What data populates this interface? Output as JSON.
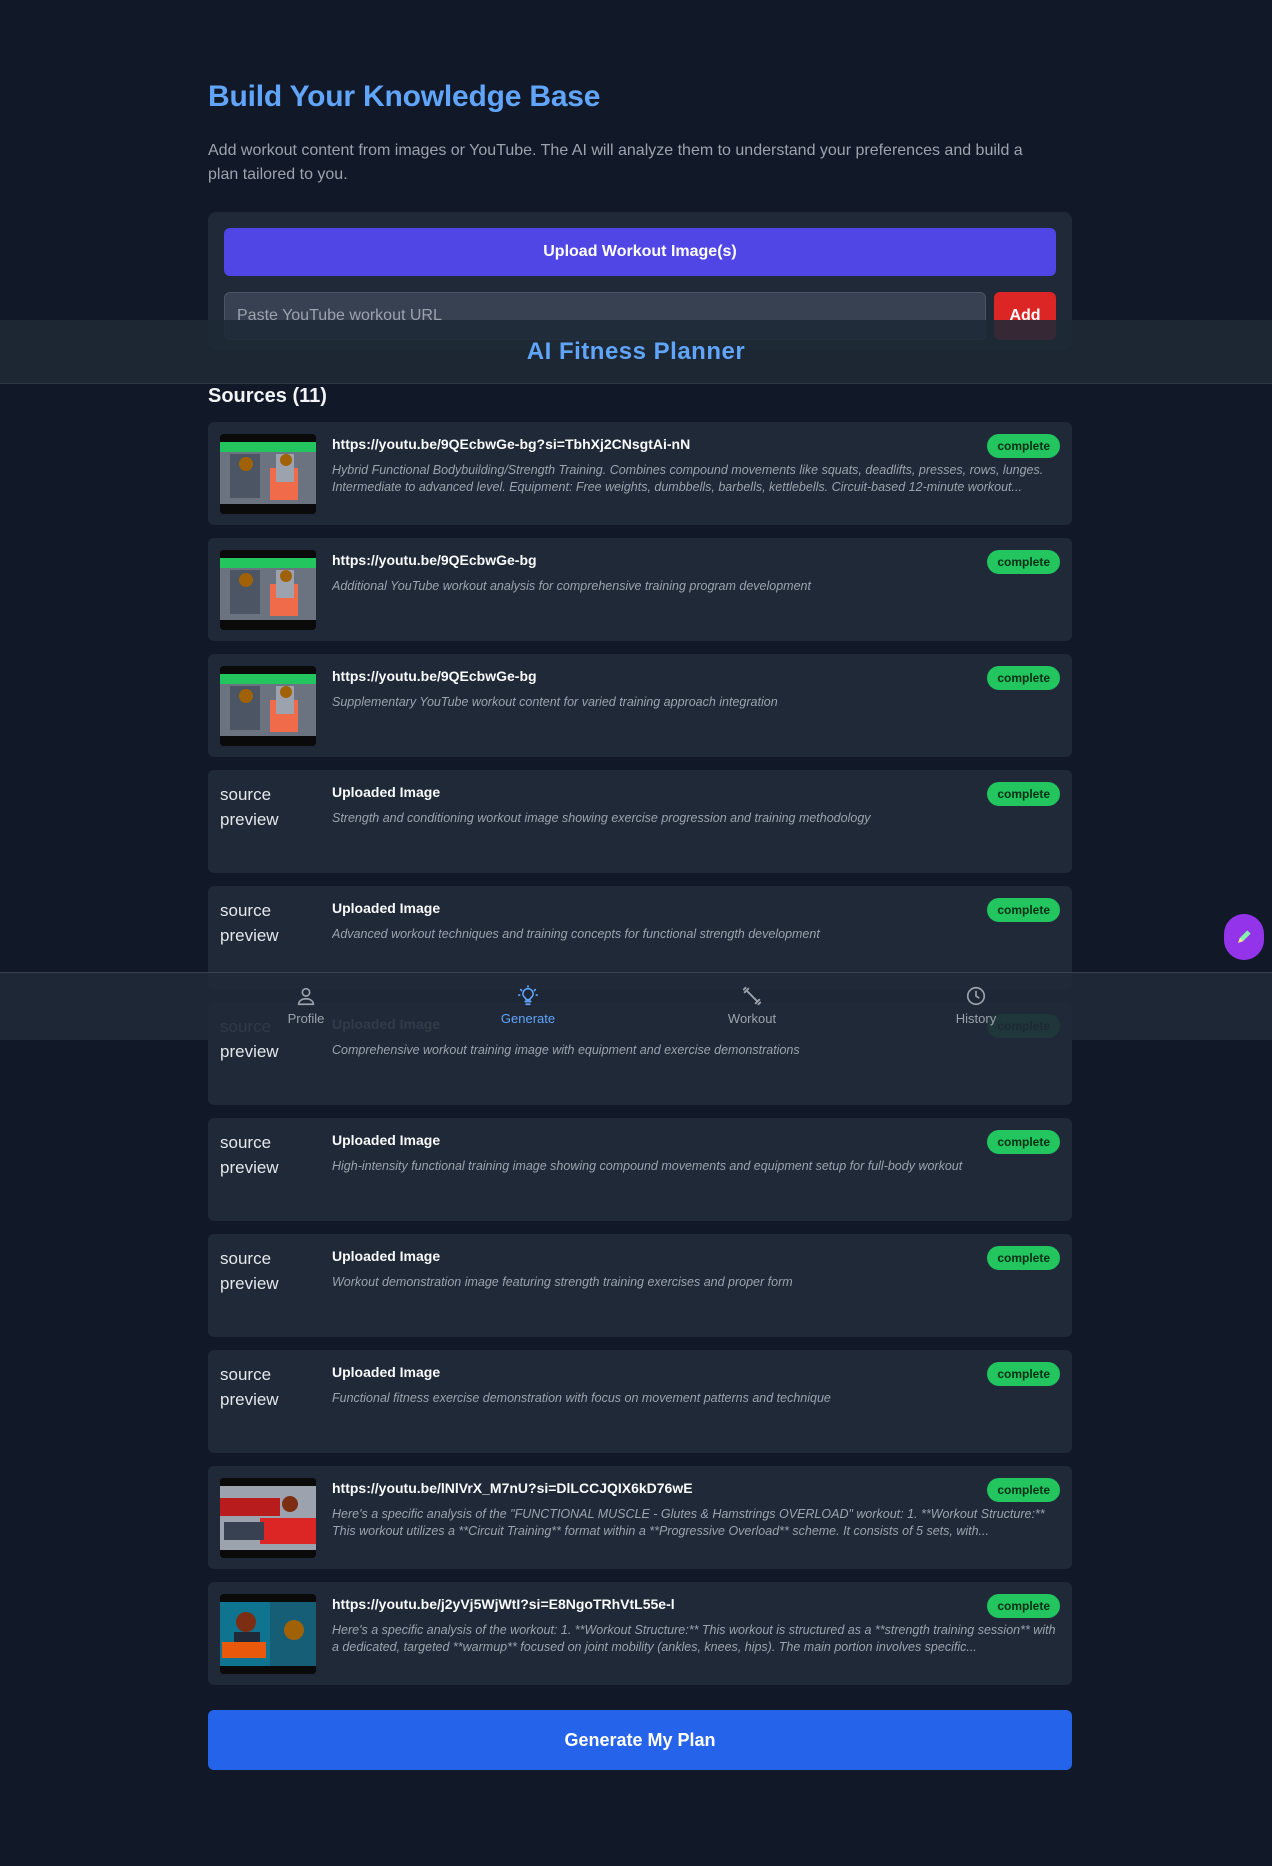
{
  "app": {
    "title": "AI Fitness Planner"
  },
  "page": {
    "title": "Build Your Knowledge Base",
    "description": "Add workout content from images or YouTube. The AI will analyze them to understand your preferences and build a plan tailored to you."
  },
  "input_card": {
    "upload_label": "Upload Workout Image(s)",
    "url_placeholder": "Paste YouTube workout URL",
    "add_label": "Add"
  },
  "sources": {
    "heading": "Sources (11)",
    "broken_image_alt": "source preview",
    "items": [
      {
        "type": "youtube",
        "thumbnail": "video-thumbnail-1",
        "title": "https://youtu.be/9QEcbwGe-bg?si=TbhXj2CNsgtAi-nN",
        "description": "Hybrid Functional Bodybuilding/Strength Training. Combines compound movements like squats, deadlifts, presses, rows, lunges. Intermediate to advanced level. Equipment: Free weights, dumbbells, barbells, kettlebells. Circuit-based 12-minute workout...",
        "status": "complete"
      },
      {
        "type": "youtube",
        "thumbnail": "video-thumbnail-1",
        "title": "https://youtu.be/9QEcbwGe-bg",
        "description": "Additional YouTube workout analysis for comprehensive training program development",
        "status": "complete"
      },
      {
        "type": "youtube",
        "thumbnail": "video-thumbnail-1",
        "title": "https://youtu.be/9QEcbwGe-bg",
        "description": "Supplementary YouTube workout content for varied training approach integration",
        "status": "complete"
      },
      {
        "type": "image",
        "title": "Uploaded Image",
        "description": "Strength and conditioning workout image showing exercise progression and training methodology",
        "status": "complete"
      },
      {
        "type": "image",
        "title": "Uploaded Image",
        "description": "Advanced workout techniques and training concepts for functional strength development",
        "status": "complete"
      },
      {
        "type": "image",
        "title": "Uploaded Image",
        "description": "Comprehensive workout training image with equipment and exercise demonstrations",
        "status": "complete"
      },
      {
        "type": "image",
        "title": "Uploaded Image",
        "description": "High-intensity functional training image showing compound movements and equipment setup for full-body workout",
        "status": "complete"
      },
      {
        "type": "image",
        "title": "Uploaded Image",
        "description": "Workout demonstration image featuring strength training exercises and proper form",
        "status": "complete"
      },
      {
        "type": "image",
        "title": "Uploaded Image",
        "description": "Functional fitness exercise demonstration with focus on movement patterns and technique",
        "status": "complete"
      },
      {
        "type": "youtube",
        "thumbnail": "video-thumbnail-2",
        "title": "https://youtu.be/lNlVrX_M7nU?si=DlLCCJQIX6kD76wE",
        "description": "Here's a specific analysis of the \"FUNCTIONAL MUSCLE - Glutes & Hamstrings OVERLOAD\" workout: 1. **Workout Structure:** This workout utilizes a **Circuit Training** format within a **Progressive Overload** scheme. It consists of 5 sets, with...",
        "status": "complete"
      },
      {
        "type": "youtube",
        "thumbnail": "video-thumbnail-3",
        "title": "https://youtu.be/j2yVj5WjWtI?si=E8NgoTRhVtL55e-l",
        "description": "Here's a specific analysis of the workout: 1. **Workout Structure:** This workout is structured as a **strength training session** with a dedicated, targeted **warmup** focused on joint mobility (ankles, knees, hips). The main portion involves specific...",
        "status": "complete"
      }
    ]
  },
  "generate": {
    "label": "Generate My Plan"
  },
  "nav": {
    "items": [
      {
        "label": "Profile",
        "icon": "person-icon",
        "active": false
      },
      {
        "label": "Generate",
        "icon": "lightbulb-icon",
        "active": true
      },
      {
        "label": "Workout",
        "icon": "dumbbell-icon",
        "active": false
      },
      {
        "label": "History",
        "icon": "clock-icon",
        "active": false
      }
    ]
  },
  "fab": {
    "icon": "pencil-icon"
  },
  "colors": {
    "background": "#111827",
    "card": "#1f2937",
    "accent_blue": "#60a5fa",
    "upload_button": "#4f46e5",
    "add_button": "#dc2626",
    "generate_button": "#2563eb",
    "status_complete": "#22c55e",
    "fab": "#9333ea"
  }
}
